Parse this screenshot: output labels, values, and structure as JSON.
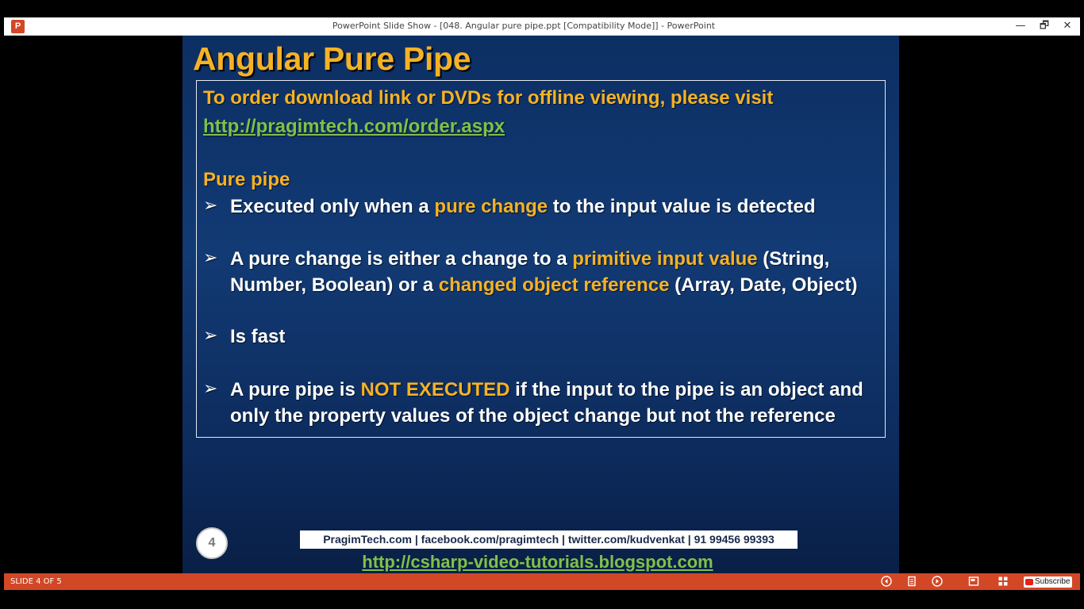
{
  "window": {
    "title": "PowerPoint Slide Show - [048. Angular pure pipe.ppt [Compatibility Mode]] - PowerPoint",
    "app_icon_letter": "P",
    "minimize": "—",
    "restore": "🗗",
    "close": "✕"
  },
  "slide": {
    "title": "Angular Pure Pipe",
    "order_text": "To order download link or DVDs for offline viewing, please visit",
    "order_link": "http://pragimtech.com/order.aspx",
    "section_heading": "Pure pipe",
    "bullet_glyph": "➢",
    "bullets": [
      {
        "parts": [
          "Executed only when a ",
          "pure change",
          " to the input value is detected"
        ]
      },
      {
        "parts": [
          "A pure change is either a change to a ",
          "primitive input value",
          " (String,"
        ],
        "line2": [
          "Number, Boolean) or a ",
          "changed object reference",
          " (Array, Date, Object)"
        ]
      },
      {
        "parts": [
          "Is fast"
        ]
      },
      {
        "parts": [
          "A pure pipe is ",
          "NOT EXECUTED",
          " if the input to the pipe is an object and"
        ],
        "line2": [
          "only the property values of the object change but not the reference"
        ]
      }
    ],
    "slide_number": "4",
    "footer_bar": "PragimTech.com | facebook.com/pragimtech | twitter.com/kudvenkat | 91 99456 99393",
    "footer_link": "http://csharp-video-tutorials.blogspot.com"
  },
  "statusbar": {
    "slide_counter": "SLIDE 4 OF 5",
    "subscribe_label": "Subscribe",
    "icons": [
      "previous-icon",
      "notes-icon",
      "next-icon",
      "normal-view-icon",
      "slide-sorter-icon"
    ]
  },
  "colors": {
    "accent_yellow": "#f5b225",
    "link_green": "#7fc14a",
    "status_orange": "#d24726",
    "slide_blue": "#123a74"
  }
}
